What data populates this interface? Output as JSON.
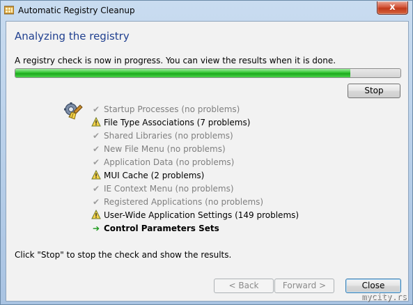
{
  "window": {
    "title": "Automatic Registry Cleanup",
    "close_glyph": "x"
  },
  "main": {
    "heading": "Analyzing the registry",
    "instruction": "A registry check is now in progress. You can view the results when it is done.",
    "progress_fraction": 0.87,
    "stop_label": "Stop",
    "items": [
      {
        "label": "Startup Processes (no problems)",
        "status": "done",
        "icon": "checkmark-icon"
      },
      {
        "label": "File Type Associations (7 problems)",
        "status": "warning",
        "icon": "warning-icon"
      },
      {
        "label": "Shared Libraries (no problems)",
        "status": "done",
        "icon": "checkmark-icon"
      },
      {
        "label": "New File Menu (no problems)",
        "status": "done",
        "icon": "checkmark-icon"
      },
      {
        "label": "Application Data (no problems)",
        "status": "done",
        "icon": "checkmark-icon"
      },
      {
        "label": "MUI Cache (2 problems)",
        "status": "warning",
        "icon": "warning-icon"
      },
      {
        "label": "IE Context Menu (no problems)",
        "status": "done",
        "icon": "checkmark-icon"
      },
      {
        "label": "Registered Applications (no problems)",
        "status": "done",
        "icon": "checkmark-icon"
      },
      {
        "label": "User-Wide Application Settings (149 problems)",
        "status": "warning",
        "icon": "warning-icon"
      },
      {
        "label": "Control Parameters Sets",
        "status": "current",
        "icon": "arrow-right-icon"
      }
    ],
    "hint": "Click \"Stop\" to stop the check and show the results."
  },
  "footer": {
    "back_label": "< Back",
    "forward_label": "Forward >",
    "close_label": "Close"
  },
  "watermark": "mycity.rs",
  "colors": {
    "heading": "#1f3f8f",
    "progress": "#32c432",
    "current_arrow": "#1c9a1c"
  }
}
